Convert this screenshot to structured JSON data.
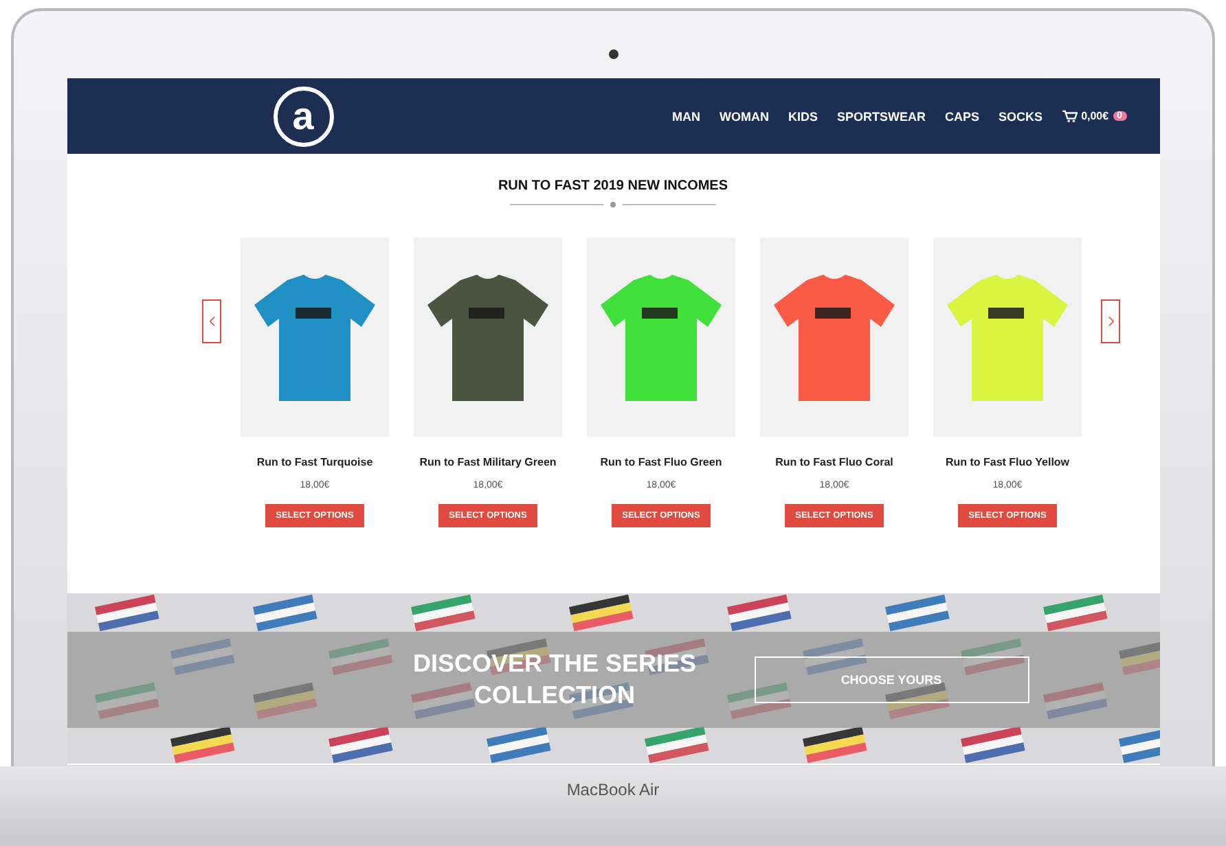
{
  "laptop": {
    "model_label": "MacBook Air"
  },
  "header": {
    "logo_text": "a",
    "nav": [
      {
        "label": "MAN"
      },
      {
        "label": "WOMAN"
      },
      {
        "label": "KIDS"
      },
      {
        "label": "SPORTSWEAR"
      },
      {
        "label": "CAPS"
      },
      {
        "label": "SOCKS"
      }
    ],
    "cart": {
      "label": "0,00€",
      "count": "0"
    }
  },
  "section_title": "RUN TO FAST 2019 NEW INCOMES",
  "products": [
    {
      "name": "Run to Fast Turquoise",
      "price": "18,00€",
      "button": "SELECT OPTIONS",
      "color": "#1f8fc4"
    },
    {
      "name": "Run to Fast Military Green",
      "price": "18,00€",
      "button": "SELECT OPTIONS",
      "color": "#4d5441"
    },
    {
      "name": "Run to Fast Fluo Green",
      "price": "18,00€",
      "button": "SELECT OPTIONS",
      "color": "#3fe03a"
    },
    {
      "name": "Run to Fast Fluo Coral",
      "price": "18,00€",
      "button": "SELECT OPTIONS",
      "color": "#fb5a45"
    },
    {
      "name": "Run to Fast Fluo Yellow",
      "price": "18,00€",
      "button": "SELECT OPTIONS",
      "color": "#d9f542"
    }
  ],
  "banner": {
    "headline": "DISCOVER THE SERIES COLLECTION",
    "button": "CHOOSE YOURS"
  }
}
